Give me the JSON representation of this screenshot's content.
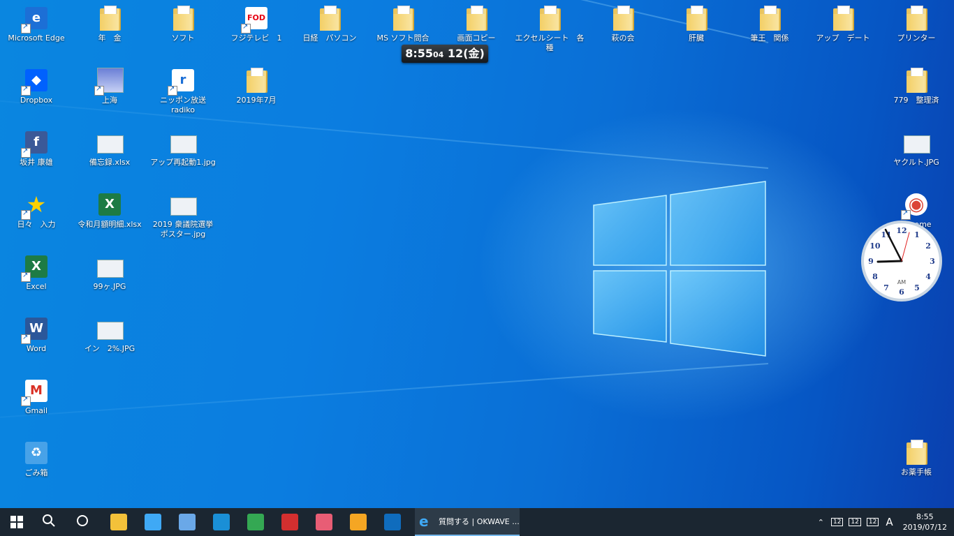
{
  "desktop": {
    "icons_left": [
      {
        "label": "Microsoft Edge",
        "icon": "edge-icon"
      },
      {
        "label": "Dropbox",
        "icon": "dropbox-icon"
      },
      {
        "label": "坂井 康雄",
        "icon": "facebook-icon"
      },
      {
        "label": "日々　入力",
        "icon": "star-icon"
      },
      {
        "label": "Excel",
        "icon": "excel-icon"
      },
      {
        "label": "Word",
        "icon": "word-icon"
      },
      {
        "label": "Gmail",
        "icon": "gmail-icon"
      },
      {
        "label": "ごみ箱",
        "icon": "recycle-bin-icon"
      }
    ],
    "icons_col2": [
      {
        "label": "年　金",
        "icon": "folder-icon"
      },
      {
        "label": "上海",
        "icon": "image-icon"
      },
      {
        "label": "備忘録.xlsx",
        "icon": "spreadsheet-thumbnail-icon"
      },
      {
        "label": "令和月額明細.xlsx",
        "icon": "excel-file-icon"
      },
      {
        "label": "99ヶ.JPG",
        "icon": "image-file-icon"
      },
      {
        "label": "イン　2%.JPG",
        "icon": "image-file-icon"
      }
    ],
    "icons_col3": [
      {
        "label": "ソフト",
        "icon": "folder-icon"
      },
      {
        "label": "ニッポン放送 radiko",
        "icon": "radiko-icon"
      },
      {
        "label": "アップ再起動1.jpg",
        "icon": "image-file-icon"
      },
      {
        "label": "2019 衆議院選挙",
        "label2": "ポスター.jpg",
        "icon": "image-file-icon"
      }
    ],
    "icons_col4": [
      {
        "label": "フジテレビ　1",
        "icon": "fod-icon"
      },
      {
        "label": "2019年7月",
        "icon": "folder-icon"
      }
    ],
    "icons_top": [
      {
        "label": "日経　パソコン",
        "icon": "folder-icon"
      },
      {
        "label": "MS ソフト問合",
        "icon": "folder-icon"
      },
      {
        "label": "画面コピー",
        "icon": "folder-icon"
      },
      {
        "label": "エクセルシート　各種",
        "icon": "folder-icon"
      },
      {
        "label": "萩の会",
        "icon": "folder-icon"
      },
      {
        "label": "肝臓",
        "icon": "folder-icon"
      },
      {
        "label": "筆王　関係",
        "icon": "folder-icon"
      },
      {
        "label": "アップ　デート",
        "icon": "folder-icon"
      },
      {
        "label": "プリンター",
        "icon": "folder-icon"
      }
    ],
    "icons_right": [
      {
        "label": "779　整理済",
        "icon": "folder-icon"
      },
      {
        "label": "ヤクルト.JPG",
        "icon": "image-file-icon"
      },
      {
        "label": "Chrome",
        "icon": "chrome-icon"
      },
      {
        "label": "お薬手帳",
        "icon": "folder-icon"
      }
    ],
    "clock_widget": {
      "time": "8:55",
      "seconds": "04",
      "date": "12(金)"
    },
    "analog_clock": {
      "numbers": [
        "12",
        "1",
        "2",
        "3",
        "4",
        "5",
        "6",
        "7",
        "8",
        "9",
        "10",
        "11"
      ],
      "am_pm": "AM"
    }
  },
  "taskbar": {
    "pinned": [
      {
        "name": "start-icon"
      },
      {
        "name": "search-icon"
      },
      {
        "name": "cortana-icon"
      },
      {
        "name": "file-explorer-icon"
      },
      {
        "name": "paint-icon"
      },
      {
        "name": "network-icon"
      },
      {
        "name": "ie-icon"
      },
      {
        "name": "maps-icon"
      },
      {
        "name": "tool-icon"
      },
      {
        "name": "palette-icon"
      },
      {
        "name": "media-player-icon"
      },
      {
        "name": "outlook-icon"
      }
    ],
    "active_app": {
      "label": "質問する | OKWAVE ...",
      "icon": "edge-icon"
    },
    "tray": {
      "items": [
        "12",
        "12",
        "12"
      ],
      "ime": "A",
      "time": "8:55",
      "date": "2019/07/12"
    }
  },
  "colors": {
    "taskbar": "#1b2631",
    "accent": "#76b9ed",
    "desktop": "#0a74da"
  }
}
